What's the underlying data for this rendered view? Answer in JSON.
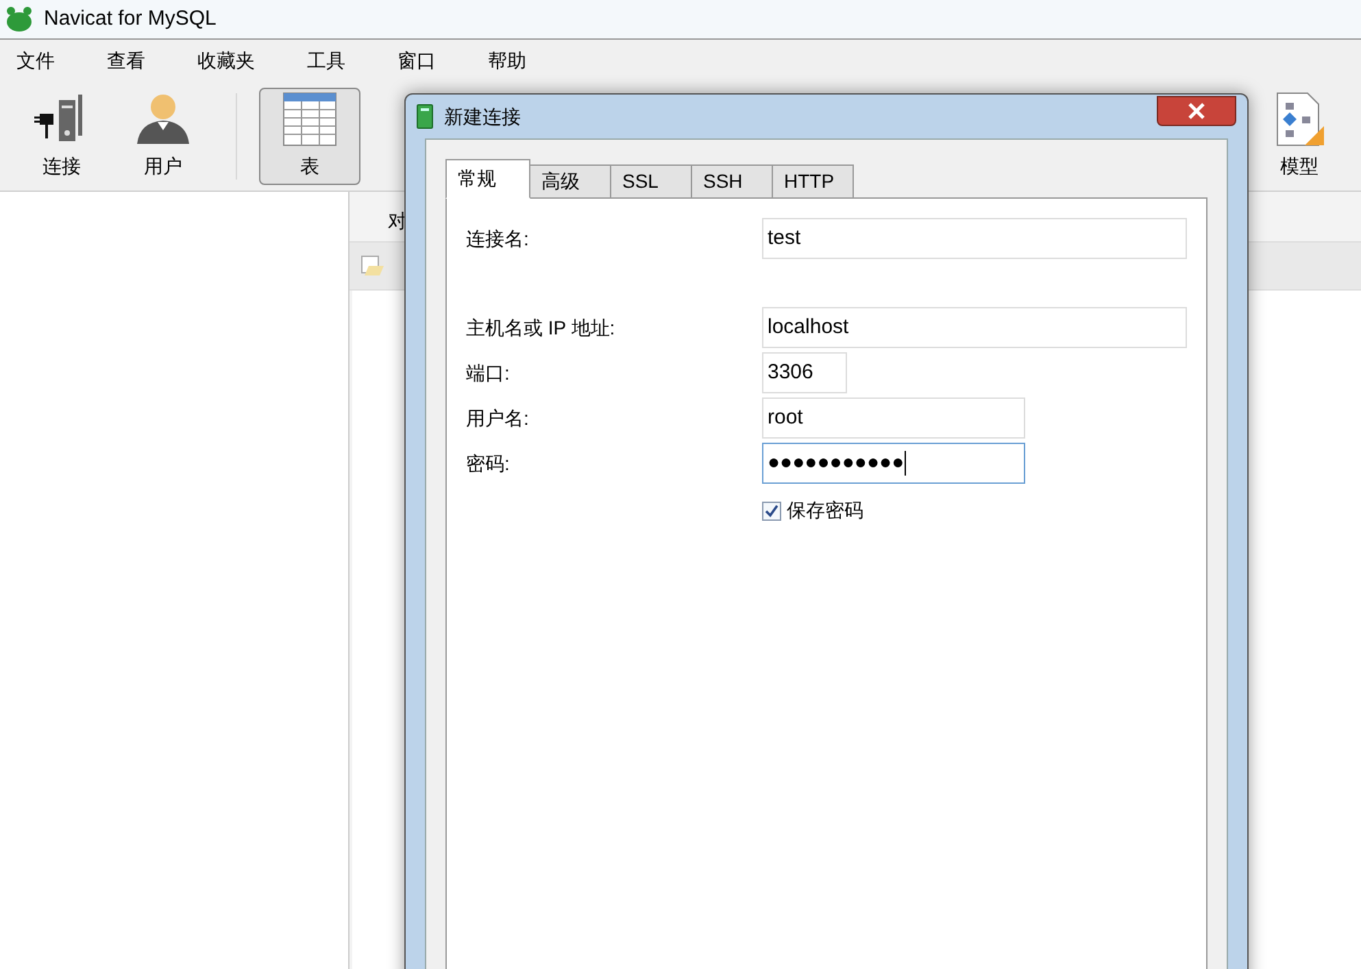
{
  "window": {
    "title": "Navicat for MySQL"
  },
  "menu": [
    "文件",
    "查看",
    "收藏夹",
    "工具",
    "窗口",
    "帮助"
  ],
  "toolbar": [
    {
      "label": "连接",
      "kind": "connect",
      "selected": false
    },
    {
      "label": "用户",
      "kind": "user",
      "selected": false
    },
    {
      "label": "表",
      "kind": "table",
      "selected": true
    },
    {
      "label": "模型",
      "kind": "model",
      "selected": false
    }
  ],
  "object_tab": {
    "label": "对"
  },
  "dialog": {
    "title": "新建连接",
    "tabs": [
      {
        "label": "常规",
        "selected": true
      },
      {
        "label": "高级",
        "selected": false
      },
      {
        "label": "SSL",
        "selected": false
      },
      {
        "label": "SSH",
        "selected": false
      },
      {
        "label": "HTTP",
        "selected": false
      }
    ],
    "fields": [
      {
        "label": "连接名:",
        "value": "test",
        "focused": false
      },
      {
        "label": "主机名或 IP 地址:",
        "value": "localhost",
        "focused": false
      },
      {
        "label": "端口:",
        "value": "3306",
        "focused": false
      },
      {
        "label": "用户名:",
        "value": "root",
        "focused": false
      },
      {
        "label": "密码:",
        "value": "●●●●●●●●●●●",
        "focused": true
      }
    ],
    "save_password": {
      "label": "保存密码",
      "checked": true
    }
  }
}
